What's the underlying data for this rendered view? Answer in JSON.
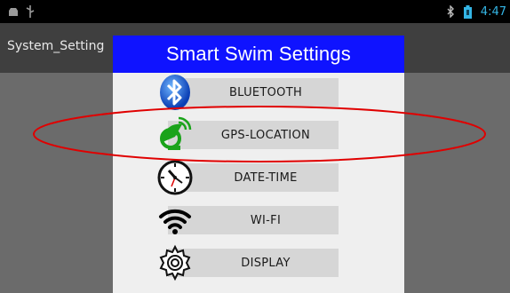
{
  "status_bar": {
    "time": "4:47",
    "icons": [
      "android-debug-icon",
      "usb-icon",
      "bluetooth-status-icon",
      "battery-icon"
    ]
  },
  "app": {
    "title": "System_Setting"
  },
  "dialog": {
    "title": "Smart Swim Settings",
    "items": [
      {
        "label": "BLUETOOTH",
        "icon": "bluetooth-icon"
      },
      {
        "label": "GPS-LOCATION",
        "icon": "gps-satellite-icon"
      },
      {
        "label": "DATE-TIME",
        "icon": "clock-icon"
      },
      {
        "label": "WI-FI",
        "icon": "wifi-icon"
      },
      {
        "label": "DISPLAY",
        "icon": "gear-icon"
      }
    ]
  },
  "annotation": {
    "shape": "ellipse",
    "color": "#e00000",
    "target": "GPS-LOCATION"
  },
  "colors": {
    "header_bg": "#0f13ff",
    "status_bar_bg": "#000000",
    "action_bar_bg": "#3f3f3f",
    "time_color": "#34b5e5"
  }
}
